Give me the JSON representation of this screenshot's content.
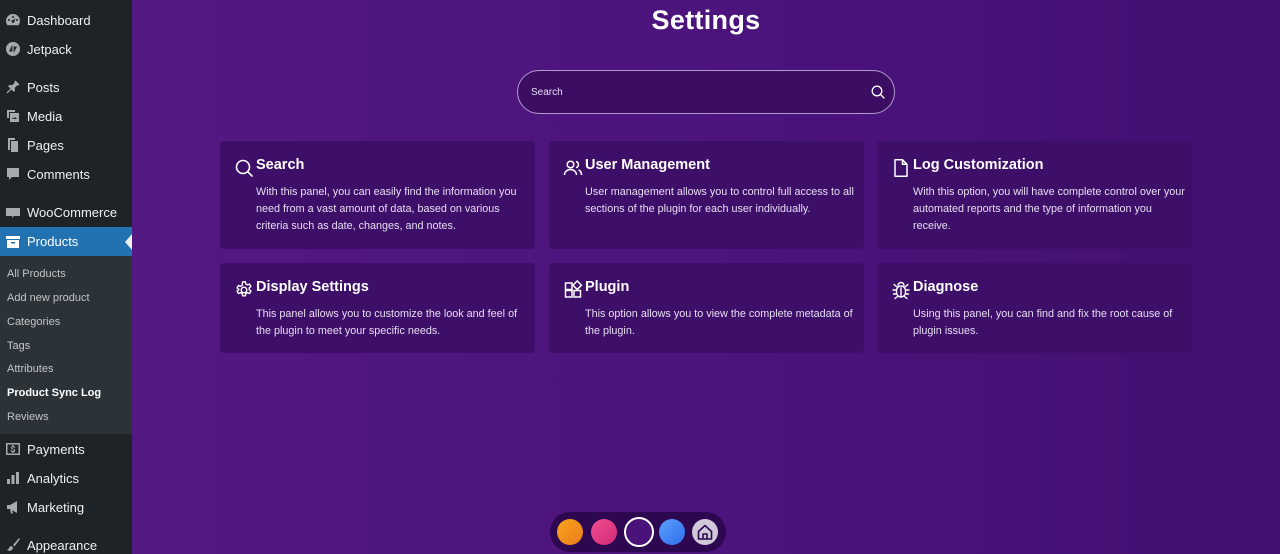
{
  "sidebar": {
    "menu": [
      {
        "label": "Dashboard",
        "icon": "dashboard-icon"
      },
      {
        "label": "Jetpack",
        "icon": "jetpack-icon"
      },
      {
        "label": "Posts",
        "icon": "pin-icon"
      },
      {
        "label": "Media",
        "icon": "media-icon"
      },
      {
        "label": "Pages",
        "icon": "pages-icon"
      },
      {
        "label": "Comments",
        "icon": "comment-icon"
      },
      {
        "label": "WooCommerce",
        "icon": "woo-icon"
      },
      {
        "label": "Products",
        "icon": "archive-icon",
        "active": true
      },
      {
        "label": "Payments",
        "icon": "dollar-icon"
      },
      {
        "label": "Analytics",
        "icon": "bar-chart-icon"
      },
      {
        "label": "Marketing",
        "icon": "megaphone-icon"
      },
      {
        "label": "Appearance",
        "icon": "brush-icon"
      }
    ],
    "submenu": [
      {
        "label": "All Products"
      },
      {
        "label": "Add new product"
      },
      {
        "label": "Categories"
      },
      {
        "label": "Tags"
      },
      {
        "label": "Attributes"
      },
      {
        "label": "Product Sync Log",
        "current": true
      },
      {
        "label": "Reviews"
      }
    ]
  },
  "main": {
    "title": "Settings",
    "search": {
      "placeholder": "Search",
      "value": ""
    },
    "cards": [
      {
        "title": "Search",
        "icon": "search-icon",
        "description": "With this panel, you can easily find the information you need from a vast amount of data, based on various criteria such as date, changes, and notes."
      },
      {
        "title": "User Management",
        "icon": "users-icon",
        "description": "User management allows you to control full access to all sections of the plugin for each user individually."
      },
      {
        "title": "Log Customization",
        "icon": "file-icon",
        "description": "With this option, you will have complete control over your automated reports and the type of information you receive."
      },
      {
        "title": "Display Settings",
        "icon": "gear-icon",
        "description": "This panel allows you to customize the look and feel of the plugin to meet your specific needs."
      },
      {
        "title": "Plugin",
        "icon": "plugin-icon",
        "description": "This option allows you to view the complete metadata of the plugin."
      },
      {
        "title": "Diagnose",
        "icon": "bug-icon",
        "description": "Using this panel, you can find and fix the root cause of plugin issues."
      }
    ],
    "theme_dock": {
      "swatches": [
        {
          "name": "orange-theme-swatch",
          "color": "#f7931e"
        },
        {
          "name": "pink-theme-swatch",
          "color": "#e93b8a"
        },
        {
          "name": "purple-theme-swatch",
          "color": "#4a137a",
          "selected": true
        },
        {
          "name": "blue-theme-swatch",
          "color": "#3f8cf5"
        }
      ],
      "home_icon": "home-icon"
    }
  },
  "colors": {
    "sidebar_bg": "#1d2327",
    "sidebar_active": "#2271b1",
    "main_bg": "#4a137a",
    "card_bg": "#3e0f68"
  }
}
